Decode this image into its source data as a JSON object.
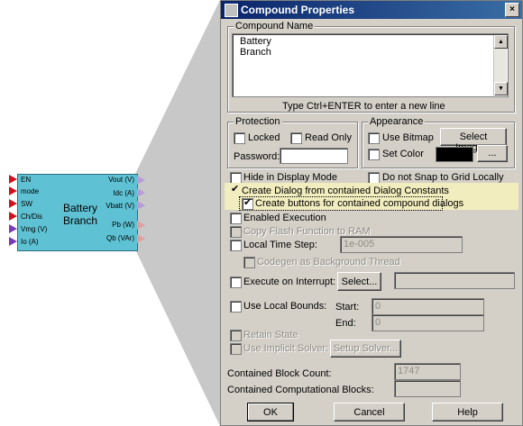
{
  "dialog": {
    "title": "Compound Properties",
    "close_glyph": "×",
    "compound_name": {
      "label": "Compound Name",
      "lines": [
        "Battery",
        "Branch"
      ],
      "hint": "Type Ctrl+ENTER to enter a new line"
    },
    "protection": {
      "label": "Protection",
      "locked": "Locked",
      "read_only": "Read Only",
      "password": "Password:"
    },
    "appearance": {
      "label": "Appearance",
      "use_bitmap": "Use Bitmap",
      "select_image": "Select Image...",
      "set_color": "Set Color",
      "color_value": "#000000",
      "ellipsis": "..."
    },
    "options": {
      "hide_display": "Hide in Display Mode",
      "no_snap": "Do not Snap to Grid Locally",
      "create_dialog": "Create Dialog from contained Dialog Constants",
      "create_buttons": "Create buttons for contained compound dialogs",
      "enabled_exec": "Enabled Execution",
      "copy_flash": "Copy Flash Function to RAM",
      "local_time": "Local Time Step:",
      "local_time_value": "1e-005",
      "codegen_bg": "Codegen as Background Thread",
      "exec_interrupt": "Execute on Interrupt:",
      "select_btn": "Select...",
      "use_local_bounds": "Use Local Bounds:",
      "start": "Start:",
      "start_value": "0",
      "end": "End:",
      "end_value": "0",
      "retain_state": "Retain State",
      "use_implicit": "Use Implicit Solver:",
      "setup_solver": "Setup Solver..."
    },
    "counts": {
      "block_count_label": "Contained Block Count:",
      "block_count_value": "1747",
      "comp_blocks_label": "Contained Computational Blocks:",
      "comp_blocks_value": ""
    },
    "buttons": {
      "ok": "OK",
      "cancel": "Cancel",
      "help": "Help"
    }
  },
  "block": {
    "title_line1": "Battery",
    "title_line2": "Branch",
    "inputs": [
      "EN",
      "mode",
      "SW",
      "Ch/Dis",
      "Vmg (V)",
      "Io (A)"
    ],
    "outputs": [
      "Vout (V)",
      "Idc (A)",
      "Vbatt (V)",
      "Pb (W)",
      "Qb (VAr)"
    ],
    "fill_color": "#5fc2d4"
  }
}
